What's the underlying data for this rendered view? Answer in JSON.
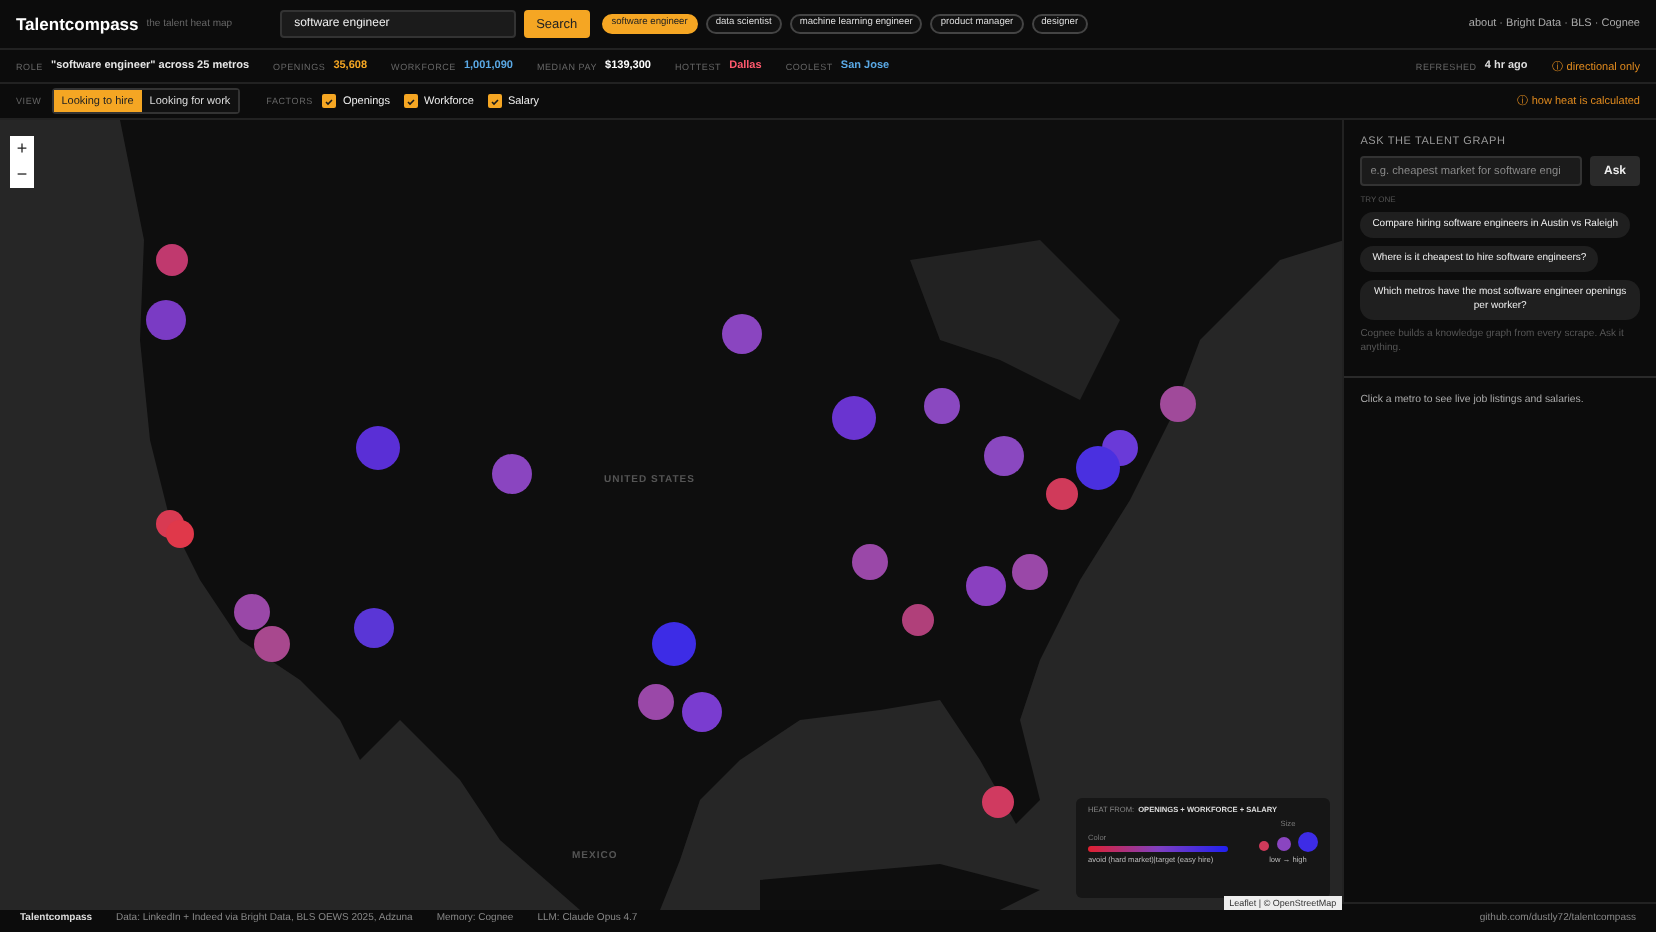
{
  "brand": {
    "name": "Talentcompass",
    "tagline": "the talent heat map"
  },
  "search": {
    "value": "software engineer",
    "button": "Search"
  },
  "roles": [
    {
      "label": "software engineer",
      "selected": true
    },
    {
      "label": "data scientist",
      "selected": false
    },
    {
      "label": "machine learning engineer",
      "selected": false
    },
    {
      "label": "product manager",
      "selected": false
    },
    {
      "label": "designer",
      "selected": false
    }
  ],
  "top_links": "about · Bright Data · BLS · Cognee",
  "stats": [
    {
      "label": "ROLE",
      "value": "\"software engineer\" across 25 metros",
      "color": "#e6e6e6"
    },
    {
      "label": "OPENINGS",
      "value": "35,608",
      "color": "#f5a623"
    },
    {
      "label": "WORKFORCE",
      "value": "1,001,090",
      "color": "#5aa9e6"
    },
    {
      "label": "MEDIAN PAY",
      "value": "$139,300",
      "color": "#ffffff"
    },
    {
      "label": "HOTTEST",
      "value": "Dallas",
      "color": "#ff5a6e"
    },
    {
      "label": "COOLEST",
      "value": "San Jose",
      "color": "#5aa9e6"
    }
  ],
  "refreshed": {
    "label": "REFRESHED",
    "value": "4 hr ago",
    "note": "ⓘ directional only"
  },
  "view": {
    "label": "VIEW",
    "options": [
      {
        "label": "Looking to hire",
        "selected": true
      },
      {
        "label": "Looking for work",
        "selected": false
      }
    ]
  },
  "factors": {
    "label": "FACTORS",
    "items": [
      {
        "label": "Openings",
        "checked": true
      },
      {
        "label": "Workforce",
        "checked": true
      },
      {
        "label": "Salary",
        "checked": true
      }
    ]
  },
  "heat_link": "ⓘ how heat is calculated",
  "map": {
    "zoom_in": "+",
    "zoom_out": "−",
    "labels": [
      {
        "text": "UNITED STATES"
      },
      {
        "text": "MEXICO"
      }
    ],
    "markers": [
      {
        "color": "#c0396e"
      },
      {
        "color": "#7a3bc4"
      },
      {
        "color": "#5a2fd6"
      },
      {
        "color": "#8a45c0"
      },
      {
        "color": "#8a45c0"
      },
      {
        "color": "#6a34d0"
      },
      {
        "color": "#8a48c0"
      },
      {
        "color": "#8a48c0"
      },
      {
        "color": "#a04a9a"
      },
      {
        "color": "#6a3ad8"
      },
      {
        "color": "#4a30e0"
      },
      {
        "color": "#d03a5a"
      },
      {
        "color": "#9a48a8"
      },
      {
        "color": "#8a40c0"
      },
      {
        "color": "#9a48a8"
      },
      {
        "color": "#b0407a"
      },
      {
        "color": "#9a48a8"
      },
      {
        "color": "#a8488e"
      },
      {
        "color": "#5a36d6"
      },
      {
        "color": "#3d2ce6"
      },
      {
        "color": "#9a48a8"
      },
      {
        "color": "#7a3cd0"
      },
      {
        "color": "#d83a52"
      },
      {
        "color": "#e0384a"
      },
      {
        "color": "#d03a60"
      }
    ],
    "legend": {
      "title_prefix": "HEAT FROM:",
      "title": "OPENINGS + WORKFORCE + SALARY",
      "color_label": "Color",
      "color_caption": "avoid (hard market)|target (easy hire)",
      "size_label": "Size",
      "size_caption": "low → high"
    },
    "attribution": "Leaflet | © OpenStreetMap"
  },
  "ask": {
    "title": "ASK THE TALENT GRAPH",
    "placeholder": "e.g. cheapest market for software engi",
    "button": "Ask",
    "try_label": "TRY ONE",
    "suggestions": [
      "Compare hiring software engineers in Austin vs Raleigh",
      "Where is it cheapest to hire software engineers?",
      "Which metros have the most software engineer openings per worker?"
    ],
    "note": "Cognee builds a knowledge graph from every scrape. Ask it anything.",
    "hint": "Click a metro to see live job listings and salaries."
  },
  "footer": [
    "Talentcompass",
    "Data: LinkedIn + Indeed via Bright Data, BLS OEWS 2025, Adzuna",
    "Memory: Cognee",
    "LLM: Claude Opus 4.7",
    "github.com/dustly72/talentcompass"
  ]
}
